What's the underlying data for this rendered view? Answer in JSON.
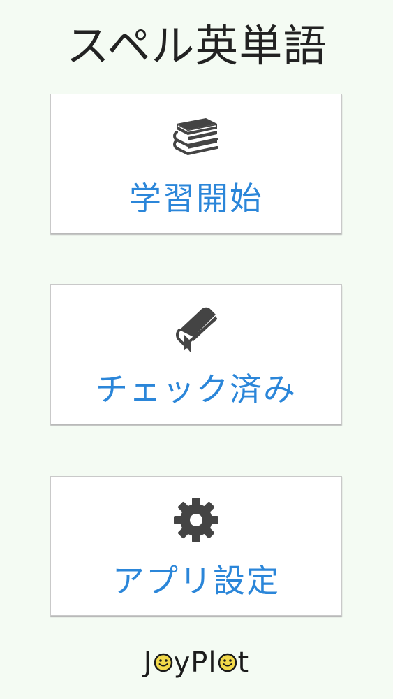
{
  "app": {
    "title": "スペル英単語"
  },
  "menu": [
    {
      "label": "学習開始",
      "icon": "books-stack-icon"
    },
    {
      "label": "チェック済み",
      "icon": "bookmarked-book-icon"
    },
    {
      "label": "アプリ設定",
      "icon": "gear-icon"
    }
  ],
  "footer": {
    "logo_parts": [
      "J",
      "yPl",
      "t"
    ]
  },
  "colors": {
    "background": "#f4fbf3",
    "accent": "#2b86d9",
    "icon": "#444444",
    "logo_smile": "#f2d94a"
  }
}
